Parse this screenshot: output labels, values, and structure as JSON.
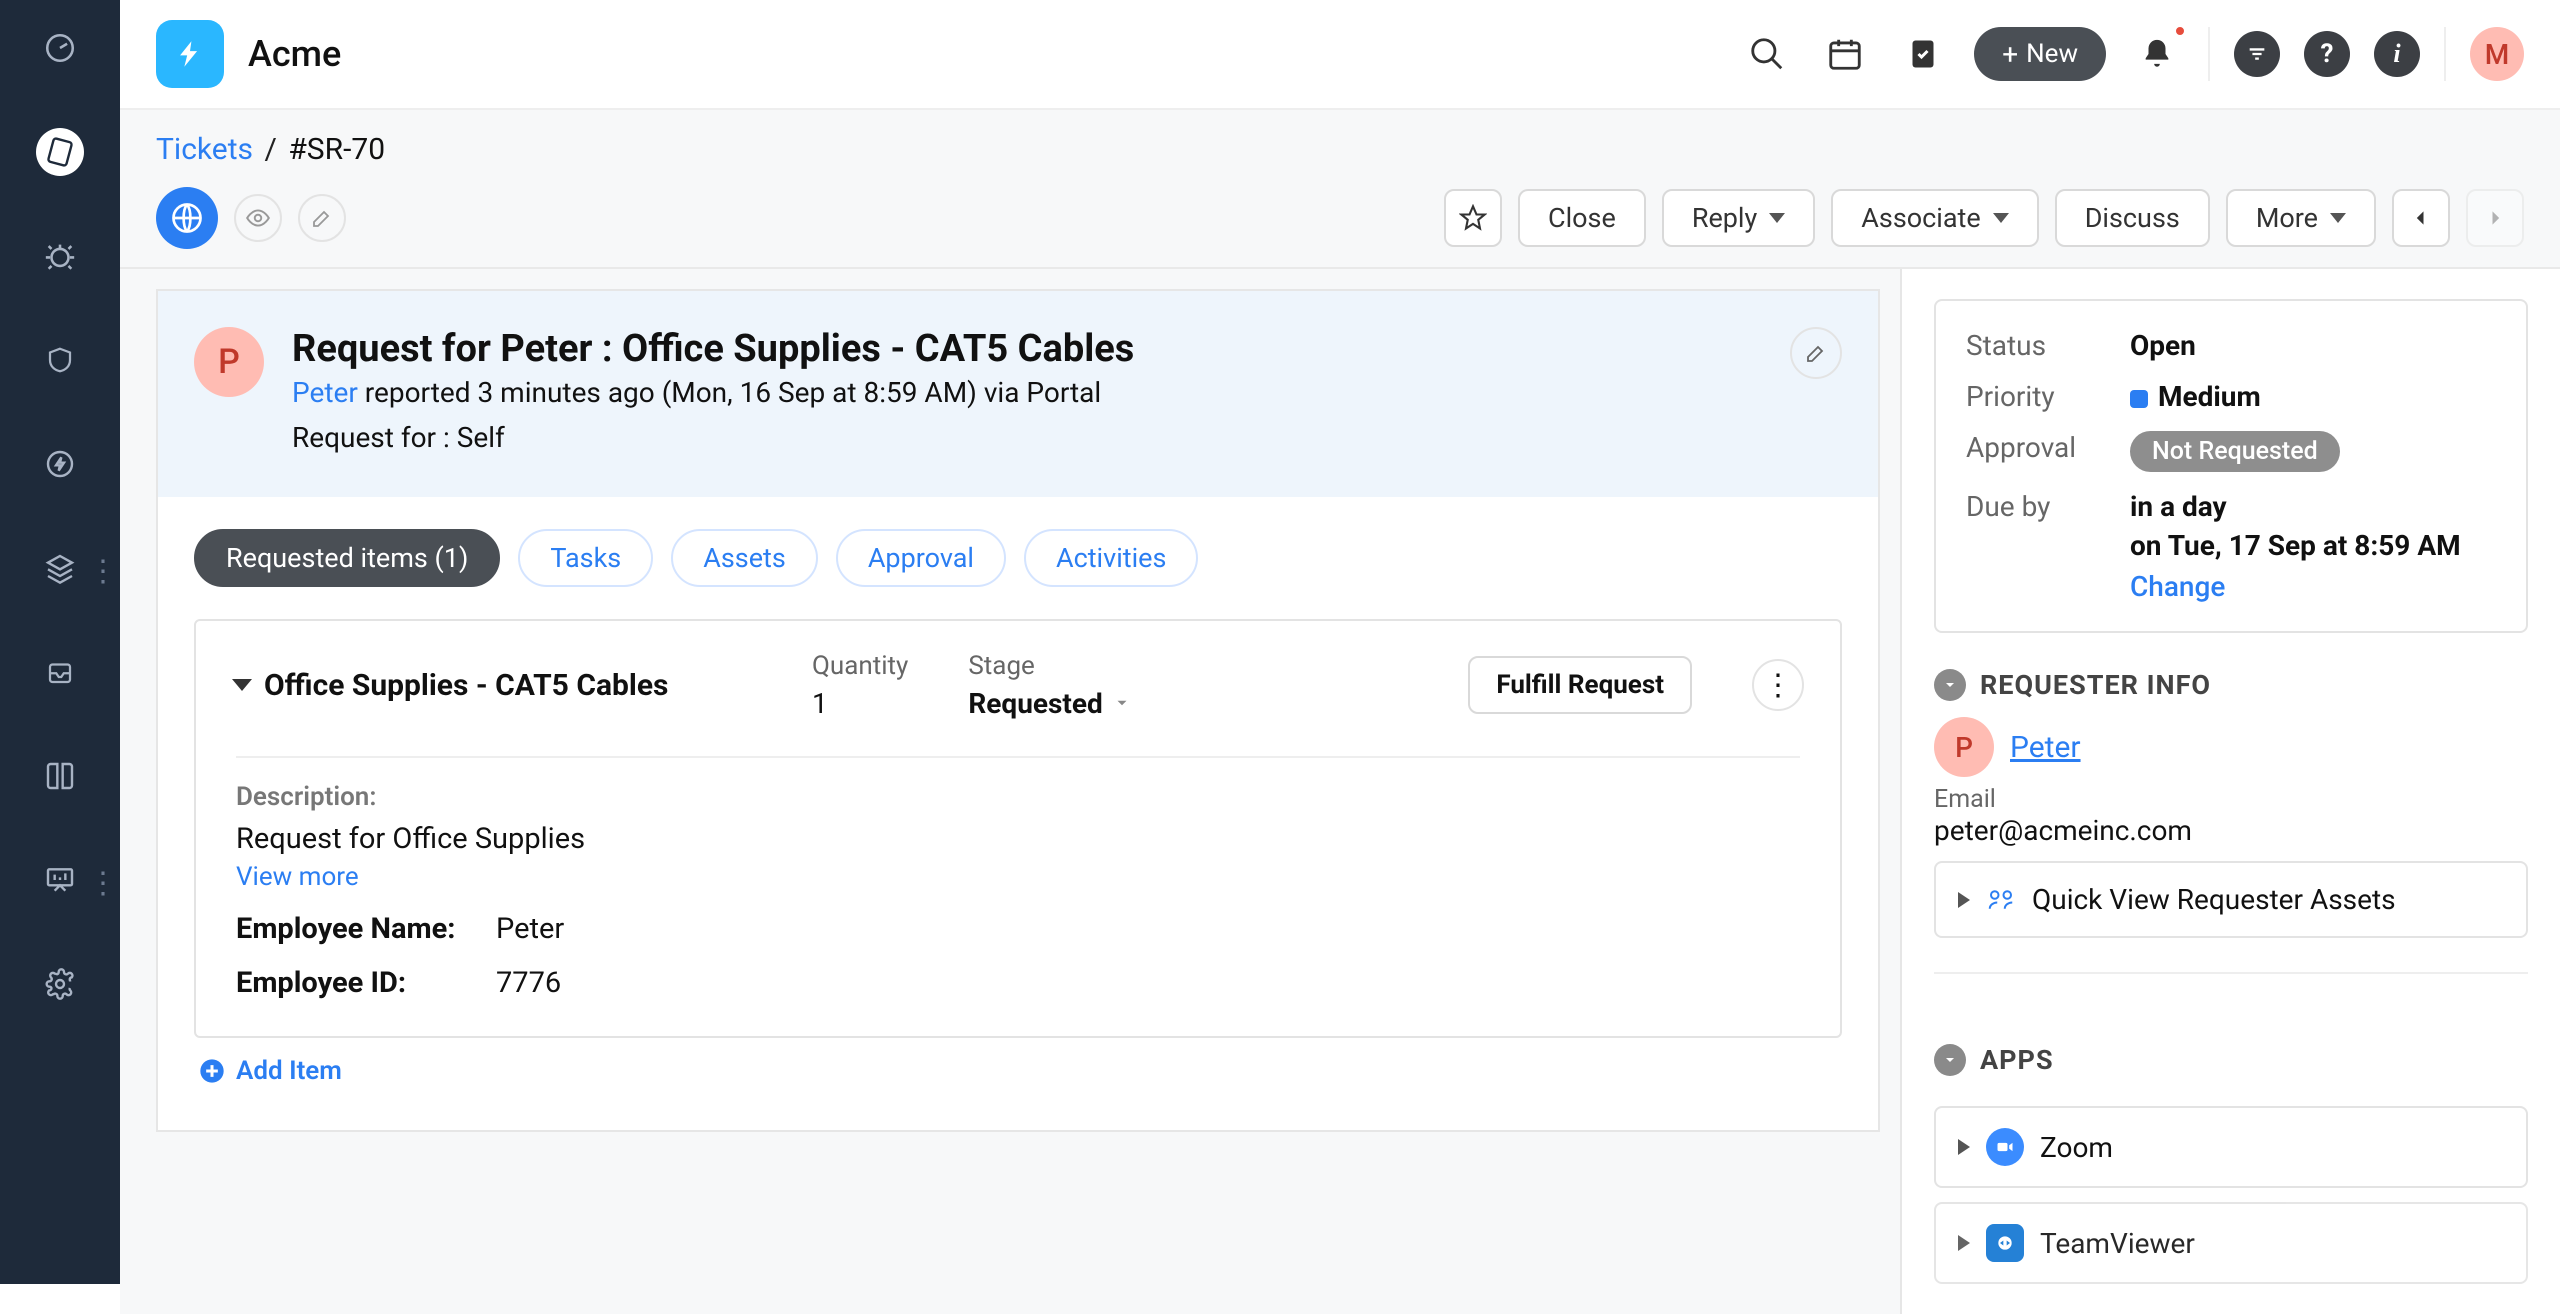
{
  "org_name": "Acme",
  "new_button": "New",
  "user_initial": "M",
  "breadcrumb": {
    "parent": "Tickets",
    "ticket_id": "#SR-70"
  },
  "toolbar": {
    "close": "Close",
    "reply": "Reply",
    "associate": "Associate",
    "discuss": "Discuss",
    "more": "More"
  },
  "ticket": {
    "title": "Request for Peter : Office Supplies - CAT5 Cables",
    "reporter_initial": "P",
    "reporter": "Peter",
    "reported_suffix": " reported 3 minutes ago (Mon, 16 Sep at 8:59 AM) via Portal",
    "request_for": "Request for : Self"
  },
  "tabs": {
    "requested_items": "Requested items (1)",
    "tasks": "Tasks",
    "assets": "Assets",
    "approval": "Approval",
    "activities": "Activities"
  },
  "item": {
    "name": "Office Supplies - CAT5 Cables",
    "quantity_label": "Quantity",
    "quantity": "1",
    "stage_label": "Stage",
    "stage": "Requested",
    "fulfill": "Fulfill Request",
    "description_label": "Description:",
    "description": "Request for Office Supplies",
    "view_more": "View more",
    "employee_name_label": "Employee Name:",
    "employee_name": "Peter",
    "employee_id_label": "Employee ID:",
    "employee_id": "7776"
  },
  "add_item": "Add Item",
  "status_panel": {
    "status_label": "Status",
    "status": "Open",
    "priority_label": "Priority",
    "priority": "Medium",
    "approval_label": "Approval",
    "approval_badge": "Not Requested",
    "due_label": "Due by",
    "due_rel": "in a day",
    "due_abs": "on Tue, 17 Sep at 8:59 AM",
    "change": "Change"
  },
  "requester_info": {
    "section": "REQUESTER INFO",
    "initial": "P",
    "name": "Peter",
    "email_label": "Email",
    "email": "peter@acmeinc.com",
    "quickview": "Quick View Requester Assets"
  },
  "apps": {
    "section": "APPS",
    "zoom": "Zoom",
    "teamviewer": "TeamViewer"
  }
}
